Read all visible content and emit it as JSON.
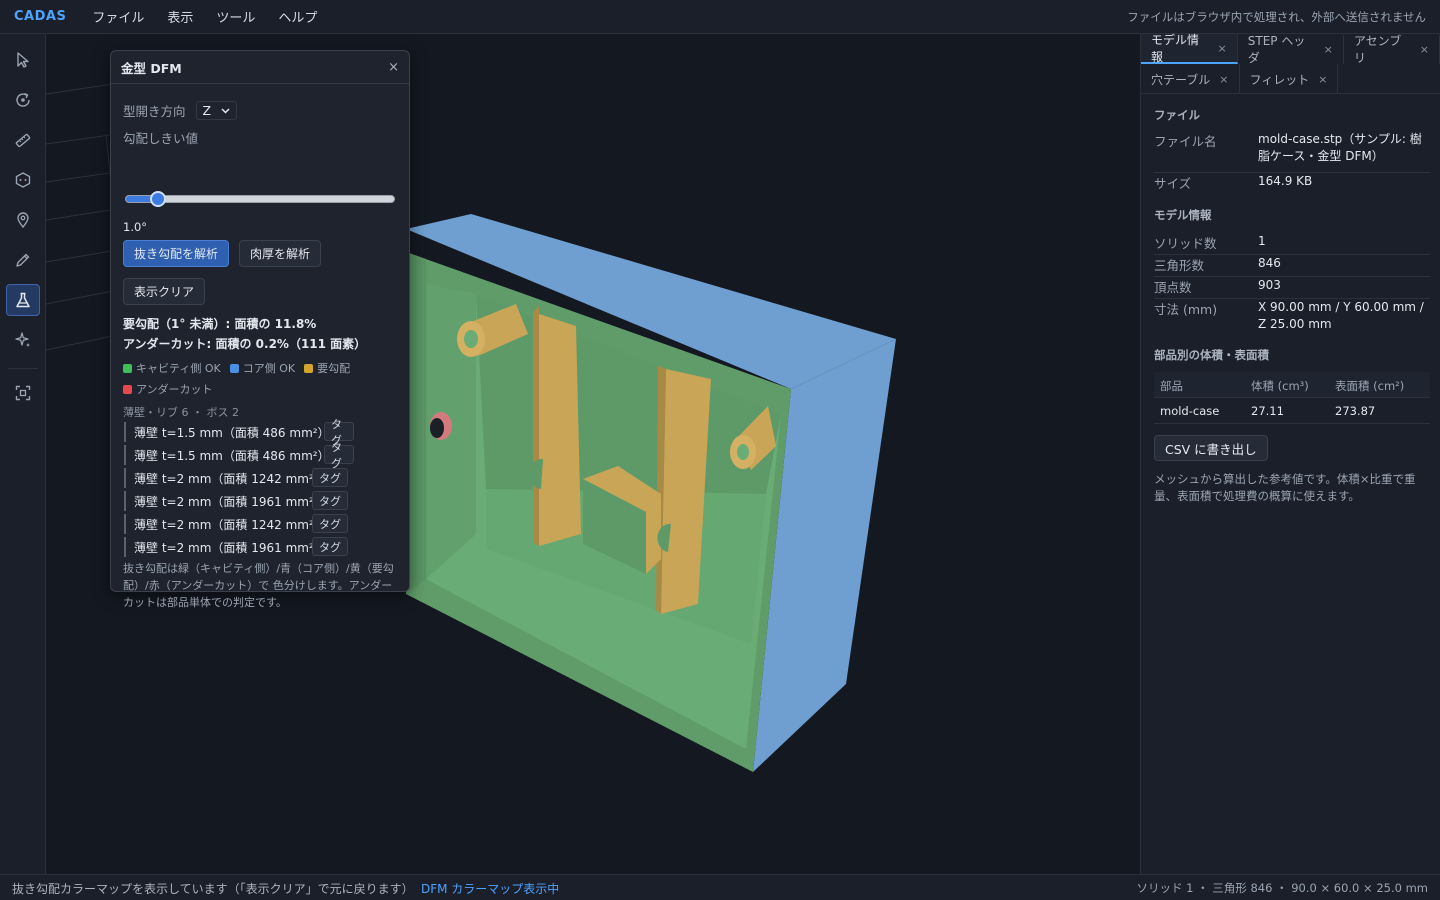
{
  "app": {
    "brand": "CADAS",
    "privacy_notice": "ファイルはブラウザ内で処理され、外部へ送信されません"
  },
  "menu": [
    "ファイル",
    "表示",
    "ツール",
    "ヘルプ"
  ],
  "tools": [
    "select-icon",
    "orbit-icon",
    "measure-icon",
    "section-icon",
    "pin-icon",
    "pen-icon",
    "mold-dfm-icon",
    "sparkle-icon",
    "fit-view-icon"
  ],
  "dfm": {
    "title": "金型 DFM",
    "close": "×",
    "direction_label": "型開き方向",
    "direction_value": "Z",
    "threshold_label": "勾配しきい値",
    "threshold_fraction": 0.12,
    "threshold_value": "1.0°",
    "analyze_draft": "抜き勾配を解析",
    "analyze_thickness": "肉厚を解析",
    "clear": "表示クリア",
    "result_draft": "要勾配（1° 未満）: 面積の 11.8%",
    "result_undercut": "アンダーカット: 面積の 0.2%（111 面素）",
    "legend": [
      {
        "label": "キャビティ側 OK",
        "color": "#3fbf5a"
      },
      {
        "label": "コア側 OK",
        "color": "#4a90e2"
      },
      {
        "label": "要勾配",
        "color": "#d4a52c"
      },
      {
        "label": "アンダーカット",
        "color": "#e5484d"
      }
    ],
    "features_summary": "薄壁・リブ 6 ・ ボス 2",
    "tag_label": "タグ",
    "features": [
      "薄壁 t=1.5 mm（面積 486 mm²）",
      "薄壁 t=1.5 mm（面積 486 mm²）",
      "薄壁 t=2 mm（面積 1242 mm²）",
      "薄壁 t=2 mm（面積 1961 mm²）",
      "薄壁 t=2 mm（面積 1242 mm²）",
      "薄壁 t=2 mm（面積 1961 mm²）"
    ],
    "note": "抜き勾配は緑（キャビティ側）/青（コア側）/黄（要勾配）/赤（アンダーカット）で 色分けします。アンダーカットは部品単体での判定です。"
  },
  "right": {
    "tabs_row1": [
      {
        "label": "モデル情報",
        "active": true
      },
      {
        "label": "STEP ヘッダ",
        "active": false
      },
      {
        "label": "アセンブリ",
        "active": false
      }
    ],
    "tabs_row2": [
      {
        "label": "穴テーブル",
        "active": false
      },
      {
        "label": "フィレット",
        "active": false
      }
    ],
    "tab_close": "×",
    "file_section": "ファイル",
    "file_name_label": "ファイル名",
    "file_name_value": "mold-case.stp（サンプル: 樹脂ケース・金型 DFM）",
    "size_label": "サイズ",
    "size_value": "164.9 KB",
    "model_section": "モデル情報",
    "solids_label": "ソリッド数",
    "solids_value": "1",
    "triangles_label": "三角形数",
    "triangles_value": "846",
    "vertices_label": "頂点数",
    "vertices_value": "903",
    "dims_label": "寸法 (mm)",
    "dims_value": "X 90.00 mm / Y 60.00 mm / Z 25.00 mm",
    "parts_section": "部品別の体積・表面積",
    "table_headers": [
      "部品",
      "体積 (cm³)",
      "表面積 (cm²)"
    ],
    "table_rows": [
      [
        "mold-case",
        "27.11",
        "273.87"
      ]
    ],
    "csv_button": "CSV に書き出し",
    "note": "メッシュから算出した参考値です。体積×比重で重量、表面積で処理費の概算に使えます。"
  },
  "status": {
    "message": "抜き勾配カラーマップを表示しています（「表示クリア」で元に戻ります）",
    "mode": "DFM カラーマップ表示中",
    "stats": "ソリッド 1 ・ 三角形 846 ・ 90.0 × 60.0 × 25.0 mm"
  },
  "colors": {
    "accent": "#4ea3ff",
    "model_core": "#6f9fd0",
    "model_cavity": "#66a872",
    "model_draft": "#c9a557",
    "model_undercut": "#d27a7d"
  }
}
